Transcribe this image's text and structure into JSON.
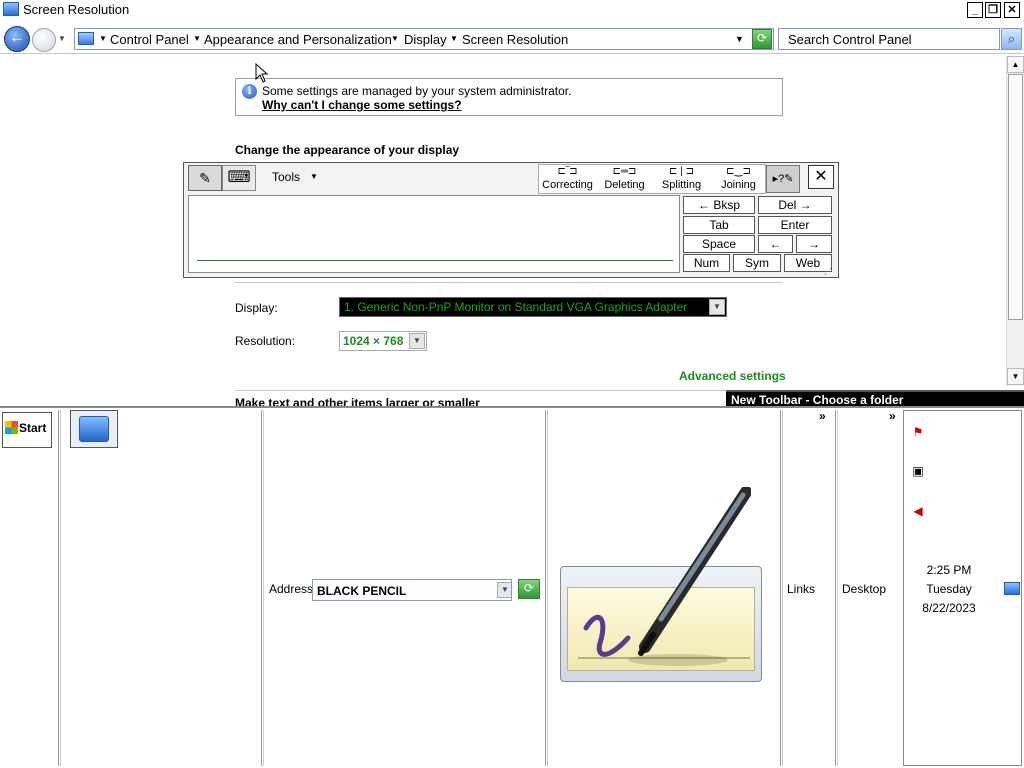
{
  "window": {
    "title": "Screen Resolution"
  },
  "controls": {
    "minimize": "_",
    "restore": "❐",
    "close": "✕"
  },
  "nav": {
    "back": "←",
    "breadcrumbs": [
      "Control Panel",
      "Appearance and Personalization",
      "Display",
      "Screen Resolution"
    ],
    "search_placeholder": "Search Control Panel"
  },
  "info": {
    "icon": "i",
    "message": "Some settings are managed by your system administrator.",
    "link": "Why can't I change some settings?"
  },
  "heading": "Change the appearance of your display",
  "input_panel": {
    "tools_label": "Tools",
    "gestures": [
      "Correcting",
      "Deleting",
      "Splitting",
      "Joining"
    ],
    "keys": {
      "bksp": "← Bksp",
      "del": "Del →",
      "tab": "Tab",
      "enter": "Enter",
      "space": "Space",
      "left": "←",
      "right": "→",
      "num": "Num",
      "sym": "Sym",
      "web": "Web"
    }
  },
  "settings": {
    "display_label": "Display:",
    "display_value": "1. Generic Non-PnP Monitor on Standard VGA Graphics Adapter",
    "resolution_label": "Resolution:",
    "resolution_value": "1024 × 768",
    "advanced_link": "Advanced settings",
    "partial_text": "Make text and other items larger or smaller"
  },
  "new_toolbar": "New Toolbar - Choose a folder",
  "taskbar": {
    "start": "Start",
    "address_label": "Address",
    "address_value": "BLACK PENCIL",
    "links": "Links",
    "desktop": "Desktop",
    "chevron": "»",
    "clock": {
      "time": "2:25 PM",
      "day": "Tuesday",
      "date": "8/22/2023"
    }
  },
  "colors": {
    "accent_green": "#1e8a1e",
    "display_select_bg": "#000000",
    "toolbar_header_bg": "#000000"
  }
}
